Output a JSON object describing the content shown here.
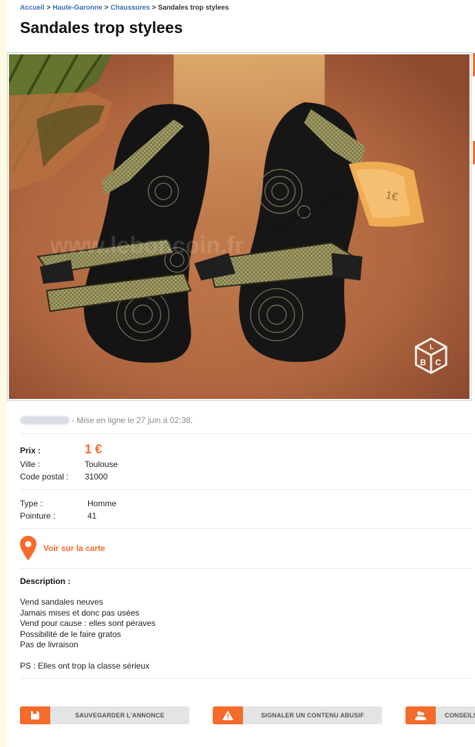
{
  "breadcrumb": {
    "items": [
      "Accueil",
      "Haute-Garonne",
      "Chaussures"
    ],
    "separator": ">",
    "current": "Sandales trop stylees"
  },
  "title": "Sandales trop stylees",
  "photo": {
    "watermark": "www.leboncoin.fr",
    "badge_letters": [
      "L",
      "B",
      "C"
    ],
    "price_tag_text": "1€"
  },
  "meta": {
    "posted_text": "- Mise en ligne le 27 juin à 02:38."
  },
  "details": {
    "price_label": "Prix :",
    "price_value": "1 €",
    "city_label": "Ville :",
    "city_value": "Toulouse",
    "zip_label": "Code postal :",
    "zip_value": "31000",
    "type_label": "Type :",
    "type_value": "Homme",
    "size_label": "Pointure :",
    "size_value": "41"
  },
  "map": {
    "label": "Voir sur la carte"
  },
  "description": {
    "title": "Description :",
    "lines": [
      "Vend sandales neuves",
      "Jamais mises et donc pas usées",
      "Vend pour cause : elles sont péraves",
      "Possibilité de le faire gratos",
      "Pas de livraison"
    ],
    "ps": "PS : Elles ont trop la classe sérieux"
  },
  "actions": {
    "save": "SAUVEGARDER L'ANNONCE",
    "report": "SIGNALER UN CONTENU ABUSIF",
    "advice": "CONSEILS"
  },
  "colors": {
    "accent": "#f56b2a",
    "link": "#3a6fb0"
  }
}
